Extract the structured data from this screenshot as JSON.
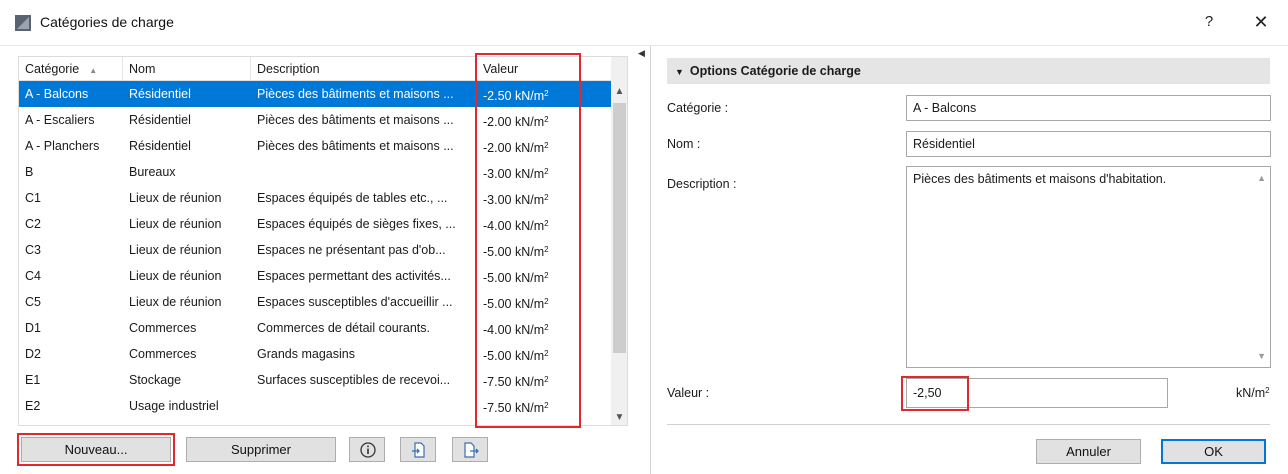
{
  "window": {
    "title": "Catégories de charge",
    "help_label": "?",
    "close_label": "✕"
  },
  "table": {
    "columns": {
      "category": "Catégorie",
      "name": "Nom",
      "description": "Description",
      "value": "Valeur"
    },
    "sort_indicator": "▲",
    "unit_base": "kN/m",
    "unit_exp": "2",
    "selected_index": 0,
    "rows": [
      {
        "category": "A - Balcons",
        "name": "Résidentiel",
        "description": "Pièces des bâtiments et maisons ...",
        "value": "-2.50"
      },
      {
        "category": "A - Escaliers",
        "name": "Résidentiel",
        "description": "Pièces des bâtiments et maisons ...",
        "value": "-2.00"
      },
      {
        "category": "A - Planchers",
        "name": "Résidentiel",
        "description": "Pièces des bâtiments et maisons ...",
        "value": "-2.00"
      },
      {
        "category": "B",
        "name": "Bureaux",
        "description": "",
        "value": "-3.00"
      },
      {
        "category": "C1",
        "name": "Lieux de réunion",
        "description": "Espaces équipés de tables etc., ...",
        "value": "-3.00"
      },
      {
        "category": "C2",
        "name": "Lieux de réunion",
        "description": "Espaces équipés de sièges fixes, ...",
        "value": "-4.00"
      },
      {
        "category": "C3",
        "name": "Lieux de réunion",
        "description": "Espaces ne présentant pas d'ob...",
        "value": "-5.00"
      },
      {
        "category": "C4",
        "name": "Lieux de réunion",
        "description": "Espaces permettant des activités...",
        "value": "-5.00"
      },
      {
        "category": "C5",
        "name": "Lieux de réunion",
        "description": "Espaces susceptibles d'accueillir ...",
        "value": "-5.00"
      },
      {
        "category": "D1",
        "name": "Commerces",
        "description": "Commerces de détail courants.",
        "value": "-4.00"
      },
      {
        "category": "D2",
        "name": "Commerces",
        "description": "Grands magasins",
        "value": "-5.00"
      },
      {
        "category": "E1",
        "name": "Stockage",
        "description": "Surfaces susceptibles de recevoi...",
        "value": "-7.50"
      },
      {
        "category": "E2",
        "name": "Usage industriel",
        "description": "",
        "value": "-7.50"
      }
    ]
  },
  "buttons": {
    "new": "Nouveau...",
    "delete": "Supprimer",
    "cancel": "Annuler",
    "ok": "OK"
  },
  "panel": {
    "header": "Options Catégorie de charge",
    "category_label": "Catégorie :",
    "category_value": "A - Balcons",
    "name_label": "Nom :",
    "name_value": "Résidentiel",
    "description_label": "Description :",
    "description_value": "Pièces des bâtiments et maisons d'habitation.",
    "value_label": "Valeur :",
    "value_value": "-2,50",
    "unit_base": "kN/m",
    "unit_exp": "2"
  },
  "colors": {
    "selection": "#0078d7",
    "highlight": "#e0282e",
    "section_header_bg": "#e5e5e5"
  },
  "icons": [
    "app-icon",
    "close-icon",
    "help-icon",
    "info-icon",
    "import-icon",
    "export-icon",
    "scroll-up-icon",
    "scroll-down-icon",
    "collapse-icon"
  ]
}
